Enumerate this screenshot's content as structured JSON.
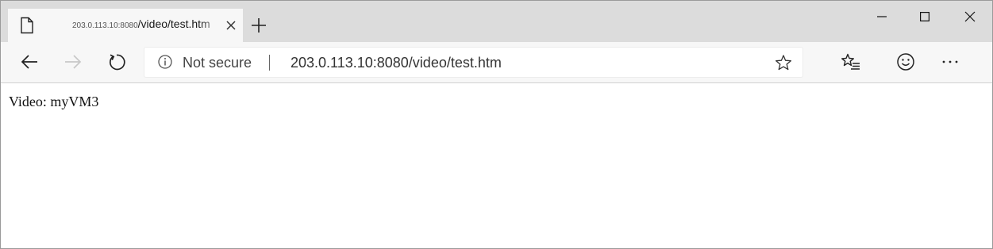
{
  "tab": {
    "host": "203.0.113.10:8080",
    "path": "/video/test.htm",
    "icon": "page-icon"
  },
  "window_controls": {
    "minimize_icon": "minimize-icon",
    "maximize_icon": "maximize-icon",
    "close_icon": "close-icon"
  },
  "toolbar": {
    "back_icon": "arrow-left-icon",
    "forward_icon": "arrow-right-icon",
    "refresh_icon": "refresh-icon",
    "favorites_icon": "favorites-icon",
    "feedback_icon": "smiley-icon",
    "more_icon": "ellipsis-icon"
  },
  "address": {
    "security_label": "Not secure",
    "url": "203.0.113.10:8080/video/test.htm",
    "favorite_icon": "star-icon"
  },
  "page": {
    "body_text": "Video: myVM3"
  },
  "colors": {
    "tabstrip_bg": "#dcdcdc",
    "toolbar_bg": "#f7f7f7",
    "forward_disabled": "#c8c8c8"
  }
}
